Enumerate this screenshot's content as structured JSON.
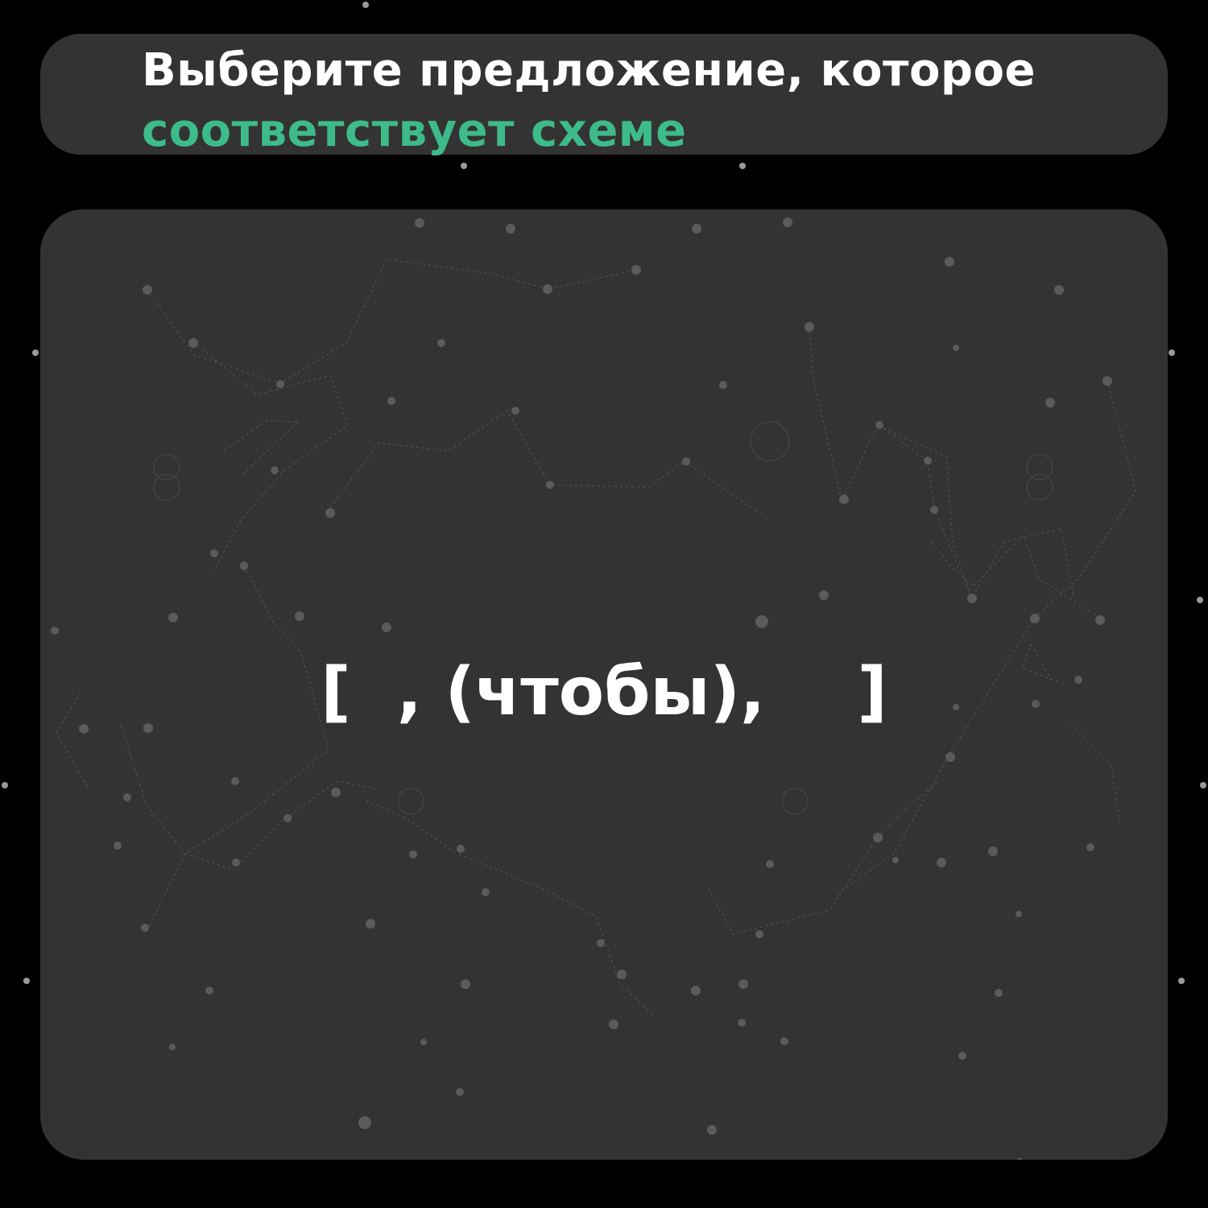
{
  "header": {
    "title_line1": "Выберите предложение, которое",
    "title_line2": "соответствует схеме",
    "accent_color": "#3dbb8a"
  },
  "scheme": {
    "text": "[  , (чтобы),    ]"
  }
}
